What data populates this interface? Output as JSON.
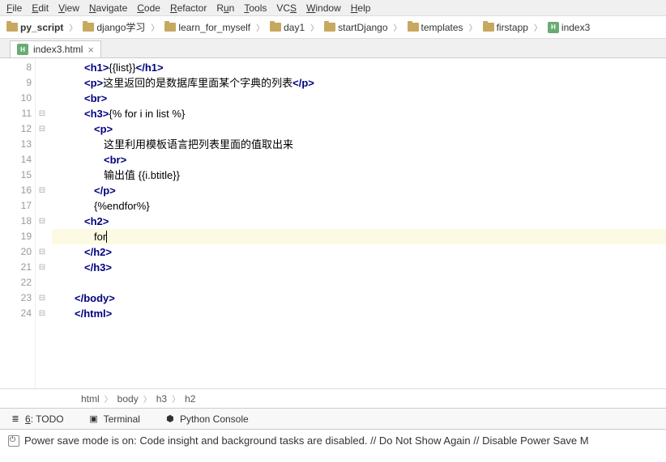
{
  "menu": {
    "file": "File",
    "edit": "Edit",
    "view": "View",
    "navigate": "Navigate",
    "code": "Code",
    "refactor": "Refactor",
    "run": "Run",
    "tools": "Tools",
    "vcs": "VCS",
    "window": "Window",
    "help": "Help"
  },
  "breadcrumb": {
    "items": [
      "py_script",
      "django学习",
      "learn_for_myself",
      "day1",
      "startDjango",
      "templates",
      "firstapp",
      "index3"
    ]
  },
  "tab": {
    "name": "index3.html"
  },
  "gutter": {
    "start": 8,
    "end": 24
  },
  "code": {
    "lines": [
      {
        "indent": 12,
        "html": "<span class='tag'>&lt;h1&gt;</span><span class='tpl'>{{list}}</span><span class='tag'>&lt;/h1&gt;</span>"
      },
      {
        "indent": 12,
        "html": "<span class='tag'>&lt;p&gt;</span><span class='txt'>这里返回的是数据库里面某个字典的列表</span><span class='tag'>&lt;/p&gt;</span>"
      },
      {
        "indent": 12,
        "html": "<span class='tag'>&lt;br&gt;</span>"
      },
      {
        "indent": 12,
        "html": "<span class='tag'>&lt;h3&gt;</span><span class='tpl'>{% for i in list %}</span>"
      },
      {
        "indent": 24,
        "html": "<span class='tag'>&lt;p&gt;</span>"
      },
      {
        "indent": 36,
        "html": "<span class='txt'>这里利用模板语言把列表里面的值取出来</span>"
      },
      {
        "indent": 36,
        "html": "<span class='tag'>&lt;br&gt;</span>"
      },
      {
        "indent": 36,
        "html": "<span class='txt'>输出值 {{i.btitle}}</span>"
      },
      {
        "indent": 24,
        "html": "<span class='tag'>&lt;/p&gt;</span>"
      },
      {
        "indent": 24,
        "html": "<span class='tpl'>{%endfor%}</span>"
      },
      {
        "indent": 12,
        "html": "<span class='tag'>&lt;h2&gt;</span>"
      },
      {
        "indent": 24,
        "html": "<span class='txt'>for</span><span class='caret'></span>",
        "hl": true
      },
      {
        "indent": 12,
        "html": "<span class='tag'>&lt;/h2&gt;</span>"
      },
      {
        "indent": 12,
        "html": "<span class='tag'>&lt;/h3&gt;</span>"
      },
      {
        "indent": 0,
        "html": ""
      },
      {
        "indent": 0,
        "html": "<span class='tag'>&lt;/body&gt;</span>"
      },
      {
        "indent": 0,
        "html": "<span class='tag'>&lt;/html&gt;</span>"
      }
    ]
  },
  "fold": [
    "",
    "",
    "",
    "⊟",
    "⊟",
    "",
    "",
    "",
    "⊟",
    "",
    "⊟",
    "",
    "⊟",
    "⊟",
    "",
    "⊟",
    "⊟"
  ],
  "bottomCrumb": {
    "a": "html",
    "b": "body",
    "c": "h3",
    "d": "h2"
  },
  "tools": {
    "todo": "6: TODO",
    "terminal": "Terminal",
    "python": "Python Console"
  },
  "status": {
    "msg": "Power save mode is on: Code insight and background tasks are disabled. // Do Not Show Again // Disable Power Save M"
  }
}
